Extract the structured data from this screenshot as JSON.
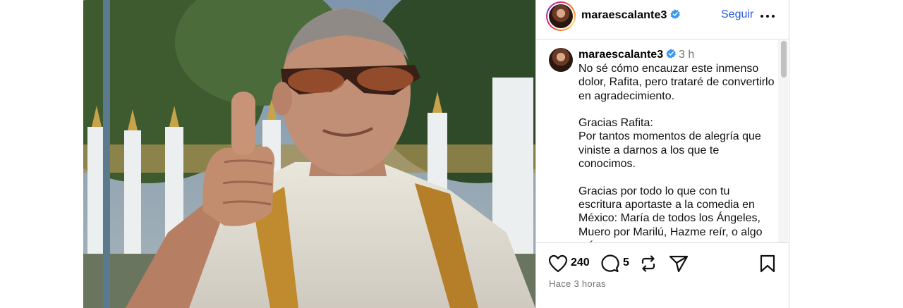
{
  "post": {
    "author": "maraescalante3",
    "verified": true,
    "follow_label": "Seguir",
    "more_label": "Más opciones"
  },
  "caption": {
    "author": "maraescalante3",
    "time_ago": "3 h",
    "text": "No sé cómo encauzar este inmenso dolor, Rafita, pero trataré de convertirlo en agradecimiento.\n\nGracias Rafita:\nPor tantos momentos de alegría que viniste a darnos a los que te conocimos.\n\nGracias por todo lo que con tu escritura aportaste a la comedia en México: María de todos los Ángeles, Muero por Marilú, Hazme reír, o algo más"
  },
  "actions": {
    "likes": "240",
    "comments": "5",
    "timestamp": "Hace 3 horas"
  },
  "colors": {
    "accent": "#2a5bd7",
    "verified": "#3897f0",
    "border": "#dbdbdb",
    "muted": "#737373"
  },
  "icons": {
    "like": "heart-outline-icon",
    "comment": "comment-bubble-icon",
    "repost": "repost-icon",
    "share": "paper-plane-icon",
    "save": "bookmark-icon",
    "more": "three-dots-icon",
    "verified": "verified-badge-icon"
  }
}
